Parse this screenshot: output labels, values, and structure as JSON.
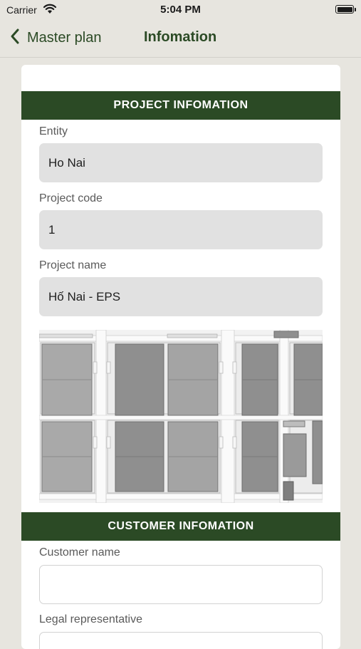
{
  "status_bar": {
    "carrier": "Carrier",
    "time": "5:04 PM"
  },
  "nav": {
    "back_label": "Master plan",
    "title": "Infomation"
  },
  "project_section": {
    "header": "PROJECT INFOMATION",
    "fields": [
      {
        "label": "Entity",
        "value": "Ho Nai"
      },
      {
        "label": "Project code",
        "value": "1"
      },
      {
        "label": "Project name",
        "value": "Hố Nai - EPS"
      }
    ]
  },
  "customer_section": {
    "header": "CUSTOMER INFOMATION",
    "fields": [
      {
        "label": "Customer name",
        "value": ""
      },
      {
        "label": "Legal representative",
        "value": ""
      }
    ]
  },
  "colors": {
    "header_bg": "#2b4a25",
    "nav_text": "#2b4a25",
    "page_bg": "#e7e5df"
  }
}
